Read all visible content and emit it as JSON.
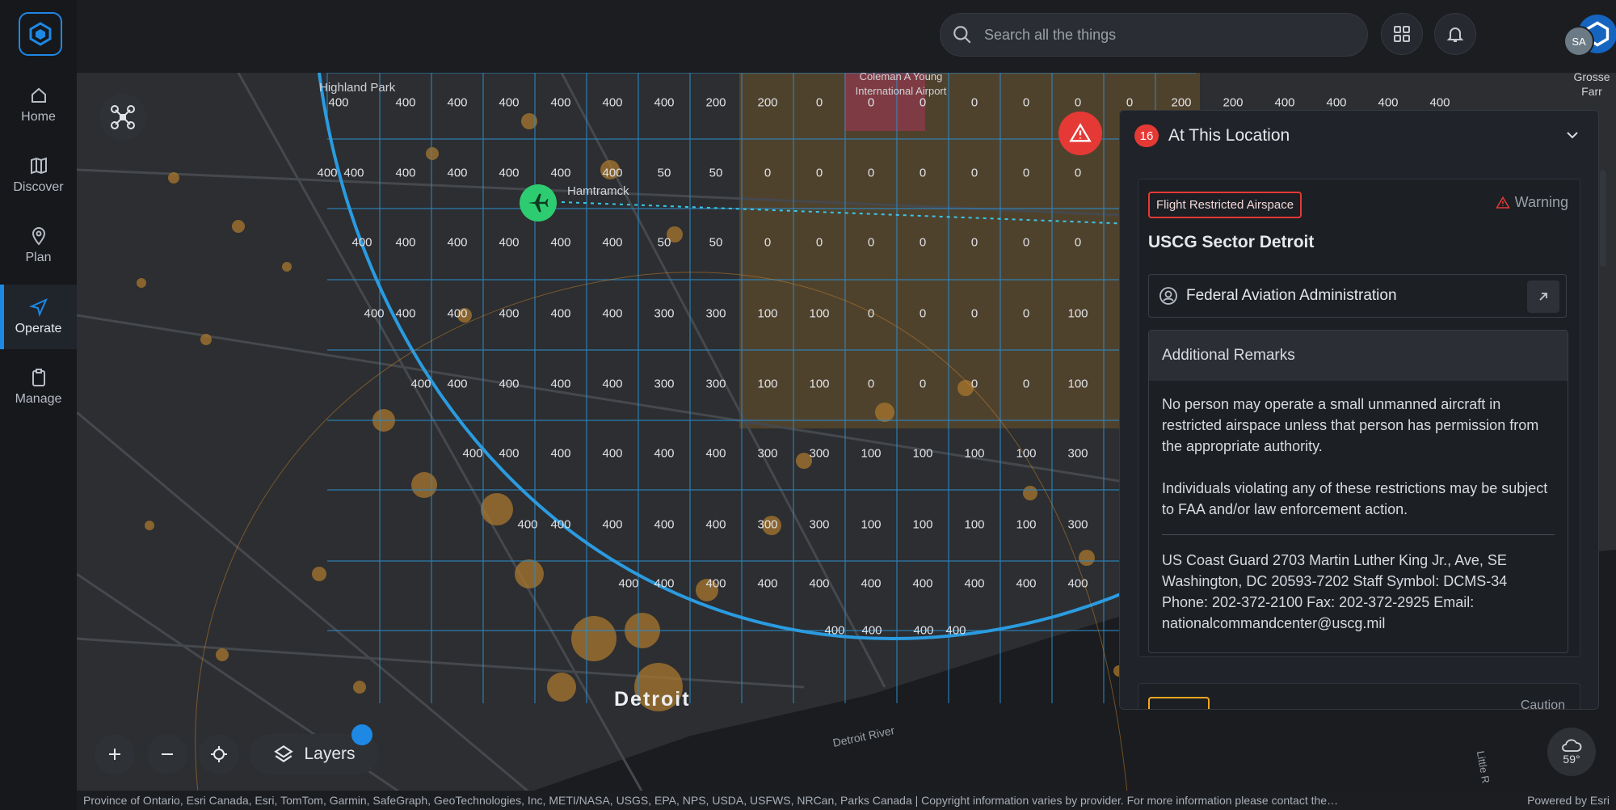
{
  "nav": {
    "items": [
      {
        "label": "Home",
        "icon": "home-icon"
      },
      {
        "label": "Discover",
        "icon": "map-icon"
      },
      {
        "label": "Plan",
        "icon": "pin-icon"
      },
      {
        "label": "Operate",
        "icon": "send-icon",
        "active": true
      },
      {
        "label": "Manage",
        "icon": "clipboard-icon"
      }
    ]
  },
  "header": {
    "search_placeholder": "Search all the things",
    "avatar_initials": "SA",
    "add_label": "+"
  },
  "map": {
    "labels": {
      "highland_park": "Highland Park",
      "hamtramck": "Hamtramck",
      "airport": "Coleman A Young International Airport",
      "detroit": "Detroit",
      "detroit_river": "Detroit River",
      "grosse": "Grosse Farr",
      "little": "Little R"
    },
    "grid_values": [
      "400",
      "400",
      "400",
      "400",
      "400",
      "400",
      "400",
      "200",
      "200",
      "0",
      "0",
      "0",
      "0",
      "0",
      "0",
      "0",
      "200",
      "200",
      "400",
      "400",
      "400",
      "400",
      "400",
      "400",
      "400",
      "400",
      "400",
      "400",
      "400",
      "50",
      "50",
      "0",
      "0",
      "0",
      "0",
      "0",
      "0",
      "0",
      "400",
      "400",
      "400",
      "400",
      "400",
      "400",
      "50",
      "50",
      "0",
      "0",
      "0",
      "0",
      "0",
      "0",
      "0",
      "400",
      "400",
      "400",
      "400",
      "400",
      "400",
      "300",
      "300",
      "100",
      "100",
      "0",
      "0",
      "0",
      "0",
      "100",
      "400",
      "400",
      "400",
      "400",
      "400",
      "300",
      "300",
      "100",
      "100",
      "0",
      "0",
      "0",
      "0",
      "100",
      "400",
      "400",
      "400",
      "400",
      "400",
      "400",
      "300",
      "300",
      "100",
      "100",
      "100",
      "100",
      "300",
      "400",
      "400",
      "400",
      "400",
      "400",
      "300",
      "300",
      "100",
      "100",
      "100",
      "100",
      "300",
      "400",
      "400",
      "400",
      "400",
      "400",
      "400",
      "400",
      "400",
      "400",
      "400",
      "400",
      "400",
      "400",
      "400",
      "400"
    ],
    "layers_label": "Layers",
    "weather_temp": "59°",
    "attribution": "Province of Ontario, Esri Canada, Esri, TomTom, Garmin, SafeGraph, GeoTechnologies, Inc, METI/NASA, USGS, EPA, NPS, USDA, USFWS, NRCan, Parks Canada | Copyright information varies by provider. For more information please contact the…",
    "powered_by": "Powered by Esri"
  },
  "panel": {
    "count": "16",
    "title": "At This Location",
    "card": {
      "tag": "Flight Restricted Airspace",
      "severity": "Warning",
      "title": "USCG Sector Detroit",
      "authority": "Federal Aviation Administration",
      "remarks_title": "Additional Remarks",
      "remarks_p1": "No person may operate a small unmanned aircraft in restricted airspace unless that person has permission from the appropriate authority.",
      "remarks_p2": "Individuals violating any of these restrictions may be subject to FAA and/or law enforcement action.",
      "remarks_p3": "US Coast Guard 2703 Martin Luther King Jr., Ave, SE Washington, DC 20593-7202 Staff Symbol: DCMS-34 Phone: 202-372-2100 Fax: 202-372-2925 Email: nationalcommandcenter@uscg.mil"
    },
    "next_severity": "Caution"
  },
  "colors": {
    "accent": "#1e88e5",
    "danger": "#e53935",
    "success": "#2ecc71",
    "caution": "#f5a623"
  }
}
